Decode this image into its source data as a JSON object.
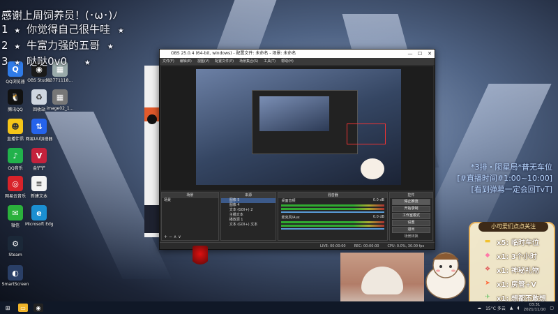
{
  "overlay": {
    "thanks_title": "感谢上周饲养员！(･ω･)ﾉ",
    "thanks_rows": [
      {
        "rank": "1",
        "name": "你觉得自己很牛哇"
      },
      {
        "rank": "2",
        "name": "牛富力强的五哥"
      },
      {
        "rank": "3",
        "name": "哒哒0v0"
      }
    ],
    "star": "★"
  },
  "desktop_icons": [
    {
      "label": "QQ浏览器",
      "icon": "qq-browser-icon",
      "color": "#2f7be8",
      "glyph": "Q"
    },
    {
      "label": "OBS Studio",
      "icon": "obs-studio-icon",
      "color": "#1a1a1a",
      "glyph": "◉"
    },
    {
      "label": "63771118...",
      "icon": "image-file-icon",
      "color": "#9aa",
      "glyph": "▦"
    },
    {
      "label": "腾讯QQ",
      "icon": "qq-penguin-icon",
      "color": "#111",
      "glyph": "🐧"
    },
    {
      "label": "回收站",
      "icon": "recycle-bin-icon",
      "color": "#cfd6e0",
      "glyph": "♻"
    },
    {
      "label": "image02_1...",
      "icon": "image-file-icon-2",
      "color": "#777",
      "glyph": "▦"
    },
    {
      "label": "直播伴侣",
      "icon": "live-companion-icon",
      "color": "#f5c518",
      "glyph": "☻"
    },
    {
      "label": "网易UU加速器",
      "icon": "uu-accelerator-icon",
      "color": "#2563eb",
      "glyph": "⇅"
    },
    {
      "label": "QQ音乐",
      "icon": "qq-music-icon",
      "color": "#21b24b",
      "glyph": "♪"
    },
    {
      "label": "金铲铲",
      "icon": "valorant-icon",
      "color": "#c5223c",
      "glyph": "V"
    },
    {
      "label": "网易云音乐",
      "icon": "netease-music-icon",
      "color": "#d8232a",
      "glyph": "◎"
    },
    {
      "label": "新建文本",
      "icon": "text-file-icon",
      "color": "#f4f4f4",
      "glyph": "≡"
    },
    {
      "label": "微信",
      "icon": "wechat-icon",
      "color": "#2bb13c",
      "glyph": "✉"
    },
    {
      "label": "Microsoft Edge",
      "icon": "edge-icon",
      "color": "#1b8fd1",
      "glyph": "e"
    },
    {
      "label": "Steam",
      "icon": "steam-icon",
      "color": "#1b2838",
      "glyph": "⚙"
    },
    {
      "label": "SmartScreen",
      "icon": "app-icon",
      "color": "#2a3f66",
      "glyph": "◐"
    }
  ],
  "obs": {
    "title": "OBS 25.0.4 (64-bit, windows) - 配置文件: 未命名 - 场景: 未命名",
    "menu": [
      "文件(F)",
      "编辑(E)",
      "视图(V)",
      "配置文件(P)",
      "场景集合(S)",
      "工具(T)",
      "帮助(H)"
    ],
    "docks": {
      "scenes_title": "场景",
      "scenes": [
        "场景"
      ],
      "sources_title": "来源",
      "sources": [
        "图像 5",
        "图像 4",
        "文本 (GDI+) 2",
        "主播文本",
        "播放源 1",
        "文本 (GDI+) 文本"
      ],
      "mixer_title": "混音器",
      "mixer": [
        {
          "name": "桌面音频",
          "db": "0.0 dB"
        },
        {
          "name": "麦克风/Aux",
          "db": "0.0 dB"
        }
      ],
      "controls_title": "控件",
      "controls": [
        "停止推流",
        "开始录制",
        "工作室模式",
        "设置",
        "退出"
      ],
      "transitions_title": "场景转换"
    },
    "status": [
      "LIVE: 00:00:00",
      "REC: 00:00:00",
      "CPU: 0.0%, 30.00 fps"
    ]
  },
  "stream_info": {
    "line1": "*3排・陨星局*普无车位",
    "line2": "[#直播时间#1:00~10:00]",
    "line3": "[看到弹幕一定会回TvT]"
  },
  "gift_panel": {
    "title": "小可爱们点点关注",
    "rows": [
      {
        "text": "x5: 临时车位",
        "icon": "gold-bar-icon",
        "color": "#f2c12e"
      },
      {
        "text": "x1: 3个小时",
        "icon": "candy-icon",
        "color": "#ff7aa8"
      },
      {
        "text": "x1: 神秘礼物",
        "icon": "gift-box-icon",
        "color": "#e05858"
      },
      {
        "text": "x1: 房管+V",
        "icon": "rocket-icon",
        "color": "#ff6b3d"
      },
      {
        "text": "x1: 想都不敢想",
        "icon": "plane-icon",
        "color": "#6bc46a"
      }
    ]
  },
  "taskbar": {
    "apps": [
      {
        "icon": "windows-start-icon",
        "color": "#fff",
        "glyph": "⊞"
      },
      {
        "icon": "file-explorer-icon",
        "color": "#f0b429",
        "glyph": "▭"
      },
      {
        "icon": "obs-taskbar-icon",
        "color": "#222",
        "glyph": "◉"
      }
    ],
    "weather": "15°C 多云",
    "time": "03:31",
    "date": "2021/11/10"
  }
}
